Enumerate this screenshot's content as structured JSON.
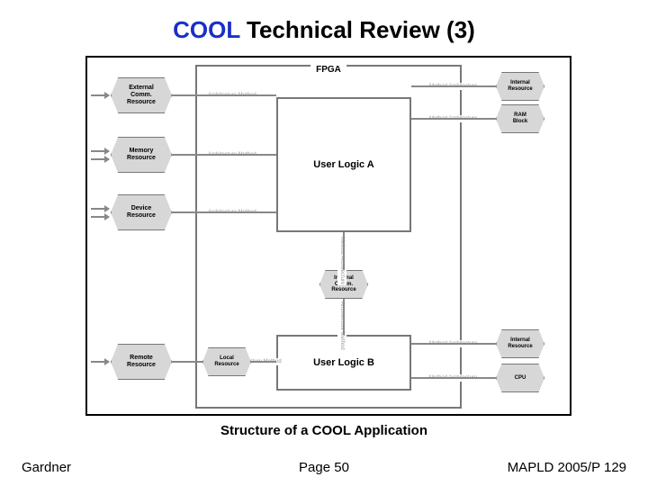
{
  "title": {
    "cool": "COOL",
    "rest": " Technical Review (3)"
  },
  "caption": "Structure of a COOL Application",
  "footer": {
    "left": "Gardner",
    "center": "Page 50",
    "right": "MAPLD 2005/P 129"
  },
  "diagram": {
    "fpga_label": "FPGA",
    "user_logic_a": "User Logic A",
    "user_logic_b": "User Logic B",
    "resources": {
      "ext_comm": "External\nComm.\nResource",
      "memory": "Memory\nResource",
      "device": "Device\nResource",
      "remote": "Remote\nResource",
      "int_res_top": "Internal\nResource",
      "ram_block": "RAM\nBlock",
      "int_comm": "Internal\nComm.\nResource",
      "local": "Local\nResource",
      "int_res_bot": "Internal\nResource",
      "cpu": "CPU"
    },
    "bridges": {
      "arch_method": "Architecture Method",
      "method_arch": "Method Architecture",
      "method_arch_v": "Method Architecture",
      "arch_method_v": "Architecture Method"
    }
  }
}
